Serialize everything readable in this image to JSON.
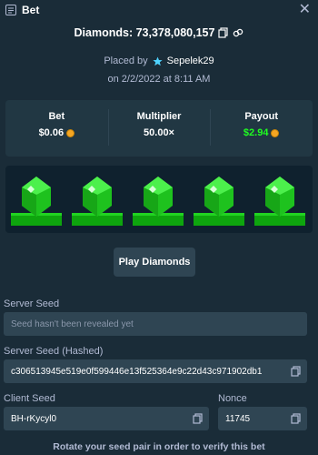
{
  "header": {
    "title": "Bet",
    "close_label": "✕"
  },
  "summary": {
    "diamonds_label": "Diamonds: 73,378,080,157",
    "placed_by_label": "Placed by",
    "username": "Sepelek29",
    "date": "on 2/2/2022 at 8:11 AM"
  },
  "stats": {
    "bet_label": "Bet",
    "bet_value": "$0.06",
    "multiplier_label": "Multiplier",
    "multiplier_value": "50.00×",
    "payout_label": "Payout",
    "payout_value": "$2.94"
  },
  "board": {
    "gems": [
      "green-gem",
      "green-gem",
      "green-gem",
      "green-gem",
      "green-gem"
    ]
  },
  "play_button_label": "Play Diamonds",
  "server_seed": {
    "label": "Server Seed",
    "placeholder": "Seed hasn't been revealed yet"
  },
  "server_seed_hashed": {
    "label": "Server Seed (Hashed)",
    "value": "c306513945e519e0f599446e13f525364e9c22d43c971902db1"
  },
  "client_seed": {
    "label": "Client Seed",
    "value": "BH-rKycyl0"
  },
  "nonce": {
    "label": "Nonce",
    "value": "11745"
  },
  "footer_text": "Rotate your seed pair in order to verify this bet",
  "colors": {
    "background": "#1a2c38",
    "panel": "#213743",
    "input": "#2f4553",
    "board": "#0f212e",
    "payout_green": "#1fff20",
    "gem_green": "#1ec21e"
  }
}
